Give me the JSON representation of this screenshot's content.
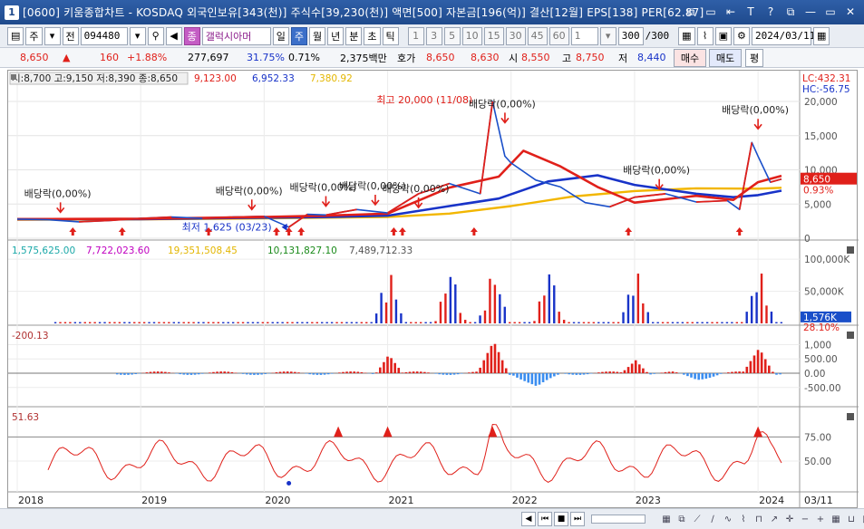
{
  "window": {
    "title": "[0600] 키움종합차트 - KOSDAQ 외국인보유[343(천)] 주식수[39,230(천)] 액면[500] 자본금[196(억)] 결산[12월] EPS[138] PER[62.87]",
    "app_icon": "1",
    "buttons": [
      "⧉",
      "▭",
      "⇤",
      "T",
      "?",
      "⧉",
      "—",
      "▭",
      "✕"
    ]
  },
  "toolbar": {
    "market_type": "주",
    "market_dropdown": "▾",
    "prev_label": "전",
    "code": "094480",
    "stock_name": "갤럭시아머",
    "stock_badge": "종",
    "periods": [
      "일",
      "주",
      "월",
      "년",
      "분",
      "초",
      "틱"
    ],
    "active_period": "주",
    "intervals": [
      "1",
      "3",
      "5",
      "10",
      "15",
      "30",
      "45",
      "60"
    ],
    "interval_value": "1",
    "count_value": "300",
    "count_total": "/300",
    "date": "2024/03/11"
  },
  "quote": {
    "price": "8,650",
    "change_arrow": "▲",
    "change": "160",
    "change_pct": "+1.88%",
    "volume": "277,697",
    "volume_pct": "31.75%",
    "turnover": "0.71%",
    "amount": "2,375백만",
    "bid_label": "호가",
    "ask": "8,650",
    "bid": "8,630",
    "open_label": "시",
    "open": "8,550",
    "high_label": "고",
    "high": "8,750",
    "low_label": "저",
    "low": "8,440",
    "buy_label": "매수",
    "sell_label": "매도",
    "avg_label": "평"
  },
  "price_panel": {
    "ohlc_label": "시:8,700 고:9,150 저:8,390 종:8,650",
    "ma_labels": [
      {
        "text": "9,123.00",
        "color": "#e0201a"
      },
      {
        "text": "6,952.33",
        "color": "#1833c8"
      },
      {
        "text": "7,380.92",
        "color": "#e3b600"
      }
    ],
    "lc_label": "LC:432.31",
    "hc_label": "HC:-56.75",
    "current_price_tag": "8,650",
    "current_pct_tag": "0.93%",
    "y_ticks": [
      "20,000",
      "15,000",
      "10,000",
      "5,000",
      "0"
    ],
    "high_annotation": "최고 20,000 (11/08)",
    "low_annotation": "최저 1,625 (03/23)",
    "dividend_label": "배당락(0,00%)"
  },
  "volume_panel": {
    "labels": [
      {
        "text": "1,575,625.00",
        "color": "#1aa8a8"
      },
      {
        "text": "7,722,023.60",
        "color": "#c000c0"
      },
      {
        "text": "19,351,508.45",
        "color": "#e3b600"
      },
      {
        "text": "10,131,827.10",
        "color": "#1a8a1a"
      },
      {
        "text": "7,489,712.33",
        "color": "#555555"
      }
    ],
    "y_ticks": [
      "100,000K",
      "50,000K"
    ],
    "current_tag": "1,576K",
    "pct_tag": "28.10%"
  },
  "macd_panel": {
    "label": "-200.13",
    "y_ticks": [
      "1,000",
      "500.00",
      "0.00",
      "-500.00"
    ]
  },
  "rsi_panel": {
    "label": "51.63",
    "y_ticks": [
      "75.00",
      "50.00"
    ]
  },
  "x_axis": {
    "years": [
      "2018",
      "2019",
      "2020",
      "2021",
      "2022",
      "2023",
      "2024"
    ],
    "end_label": "03/11"
  },
  "colors": {
    "up": "#e0201a",
    "down": "#1833c8",
    "ma_short": "#e0201a",
    "ma_mid": "#1833c8",
    "ma_long": "#f2b600",
    "active_tab": "#3b6fc9"
  },
  "chart_data": {
    "type": "line",
    "title": "",
    "series": [
      {
        "name": "",
        "role": "close",
        "x": [
          2018.0,
          2018.25,
          2018.5,
          2018.75,
          2019.0,
          2019.25,
          2019.5,
          2019.75,
          2020.0,
          2020.2,
          2020.35,
          2020.5,
          2020.75,
          2021.0,
          2021.25,
          2021.5,
          2021.75,
          2021.85,
          2021.95,
          2022.0,
          2022.2,
          2022.4,
          2022.6,
          2022.8,
          2023.0,
          2023.25,
          2023.5,
          2023.75,
          2023.85,
          2023.95,
          2024.0,
          2024.1,
          2024.19
        ],
        "values": [
          2800,
          2700,
          2400,
          2600,
          2900,
          3100,
          2900,
          3100,
          3200,
          1625,
          3500,
          3400,
          4200,
          3700,
          6500,
          8000,
          6500,
          20000,
          12000,
          11000,
          8500,
          7500,
          5200,
          4600,
          6000,
          6500,
          5300,
          5500,
          4200,
          14000,
          12000,
          8200,
          8650
        ]
      },
      {
        "name": "",
        "role": "ma-short",
        "x": [
          2018.0,
          2019.0,
          2020.0,
          2020.5,
          2021.0,
          2021.5,
          2021.9,
          2022.1,
          2022.4,
          2022.7,
          2023.0,
          2023.5,
          2023.8,
          2024.0,
          2024.19
        ],
        "values": [
          2800,
          2850,
          3100,
          3300,
          3600,
          7400,
          9000,
          12800,
          10500,
          7500,
          5200,
          6200,
          5600,
          8200,
          9123
        ]
      },
      {
        "name": "",
        "role": "ma-mid",
        "x": [
          2018.0,
          2019.0,
          2020.0,
          2020.5,
          2021.0,
          2021.5,
          2021.9,
          2022.3,
          2022.7,
          2023.0,
          2023.5,
          2023.8,
          2024.0,
          2024.19
        ],
        "values": [
          2800,
          2800,
          3000,
          3100,
          3300,
          4700,
          5800,
          8300,
          9200,
          7800,
          6500,
          6000,
          6300,
          6952
        ]
      },
      {
        "name": "",
        "role": "ma-long",
        "x": [
          2018.0,
          2019.0,
          2020.0,
          2020.5,
          2021.0,
          2021.5,
          2022.0,
          2022.5,
          2023.0,
          2023.5,
          2024.0,
          2024.19
        ],
        "values": [
          2700,
          2750,
          2900,
          3000,
          3100,
          3600,
          4700,
          6100,
          6900,
          7300,
          7250,
          7381
        ]
      }
    ],
    "ylim": [
      0,
      20000
    ],
    "xlim": [
      2018,
      2024.19
    ],
    "annotations": [
      {
        "text": "최고 20,000 (11/08)",
        "x": 2021.85,
        "y": 20000
      },
      {
        "text": "최저 1,625 (03/23)",
        "x": 2020.2,
        "y": 1625
      }
    ],
    "grid": true,
    "legend": "top-left"
  }
}
